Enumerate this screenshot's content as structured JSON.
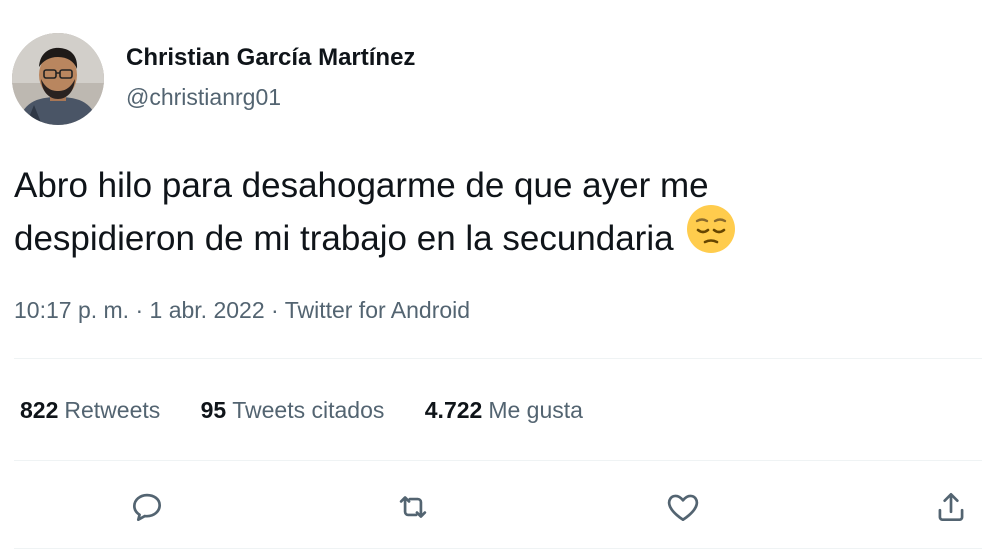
{
  "user": {
    "display_name": "Christian García Martínez",
    "handle": "@christianrg01",
    "avatar_icon": "profile-photo"
  },
  "tweet": {
    "text_line1": "Abro hilo para desahogarme de que ayer me",
    "text_line2": "despidieron de mi trabajo en la secundaria",
    "emoji_icon": "pensive-face-emoji",
    "time": "10:17 p. m.",
    "separator": "·",
    "date": "1 abr. 2022",
    "source": "Twitter for Android"
  },
  "stats": {
    "retweets_count": "822",
    "retweets_label": "Retweets",
    "quotes_count": "95",
    "quotes_label": "Tweets citados",
    "likes_count": "4.722",
    "likes_label": "Me gusta"
  },
  "actions": {
    "reply_icon": "reply-icon",
    "retweet_icon": "retweet-icon",
    "like_icon": "heart-icon",
    "share_icon": "share-icon"
  },
  "colors": {
    "text_primary": "#0f1419",
    "text_secondary": "#536471",
    "divider": "#eff3f4",
    "emoji_yellow": "#ffcc4d"
  }
}
